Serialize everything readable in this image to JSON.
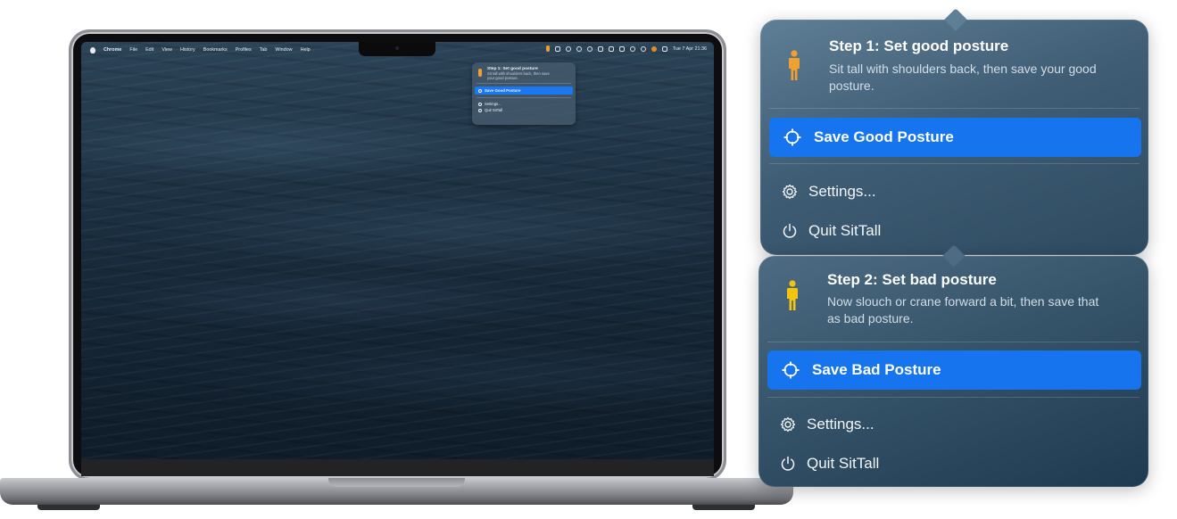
{
  "colors": {
    "accent_blue": "#1674ee",
    "good_posture_figure": "#f0a030",
    "bad_posture_figure": "#f2c511"
  },
  "laptop": {
    "menubar": {
      "app_name": "Chrome",
      "menus": [
        "File",
        "Edit",
        "View",
        "History",
        "Bookmarks",
        "Profiles",
        "Tab",
        "Window",
        "Help"
      ],
      "clock": "Tue 7 Apr 21:36"
    },
    "mini_menu": {
      "title": "Step 1: Set good posture",
      "description": "Sit tall with shoulders back, then save your good posture.",
      "primary": "Save Good Posture",
      "settings": "Settings...",
      "quit": "Quit SitTall"
    }
  },
  "step1": {
    "icon": "person-icon",
    "title": "Step 1: Set good posture",
    "description": "Sit tall with shoulders back, then save your good posture.",
    "primary_button": "Save Good Posture",
    "settings": "Settings...",
    "quit": "Quit SitTall"
  },
  "step2": {
    "icon": "person-icon",
    "title": "Step 2: Set bad posture",
    "description": "Now slouch or crane forward a bit, then save that as bad posture.",
    "primary_button": "Save Bad Posture",
    "settings": "Settings...",
    "quit": "Quit SitTall"
  }
}
